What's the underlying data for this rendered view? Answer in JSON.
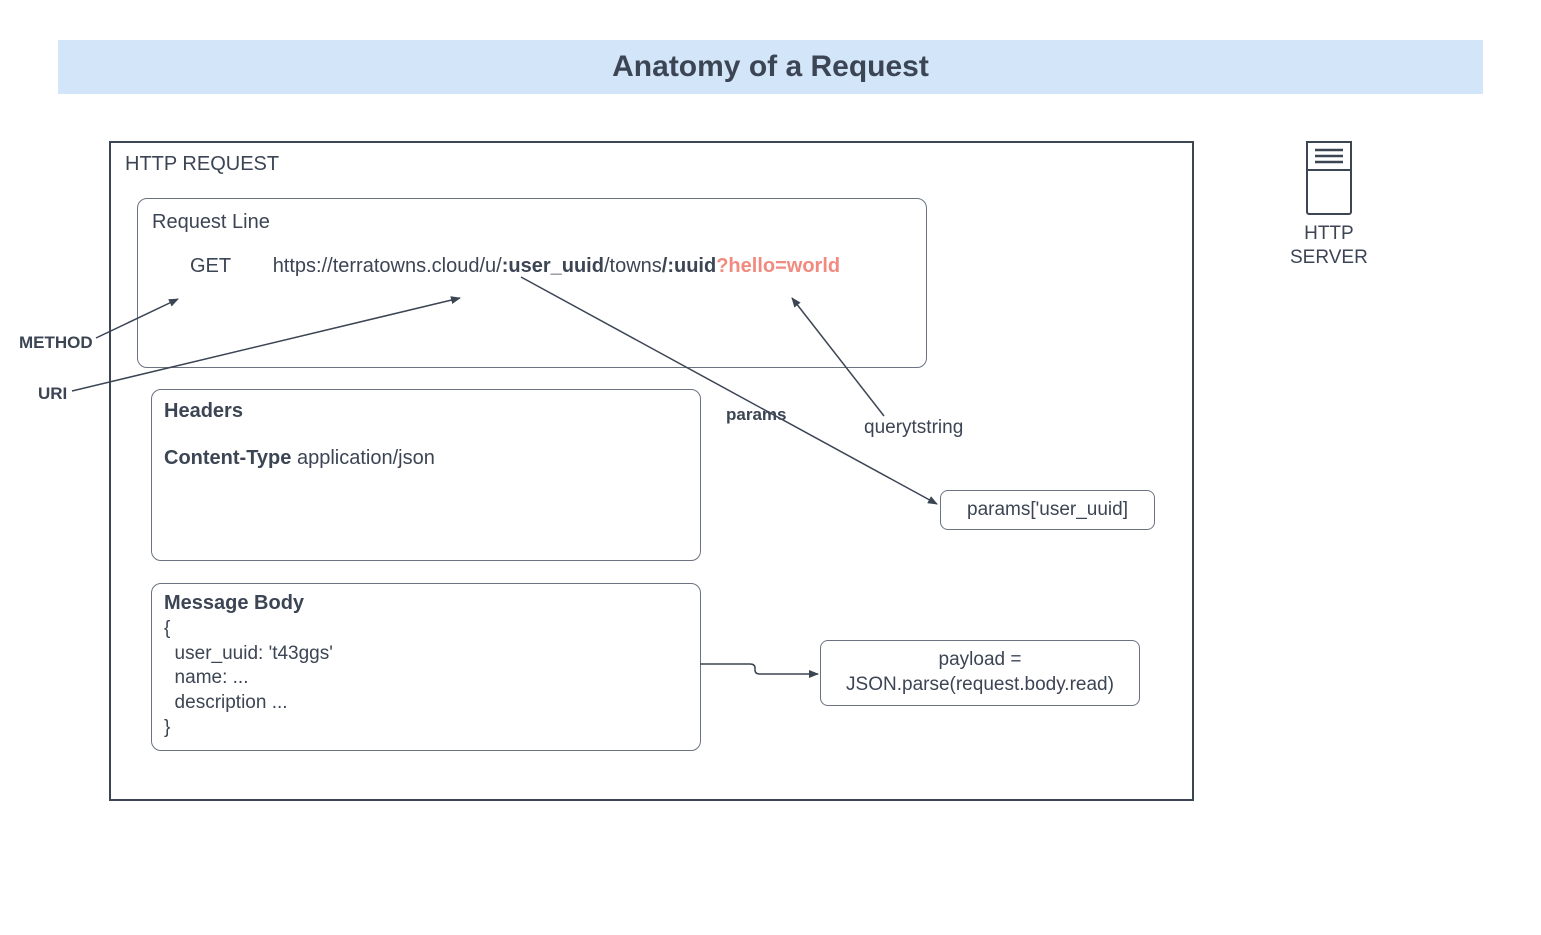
{
  "title": "Anatomy of a Request",
  "http_request_label": "HTTP REQUEST",
  "http_server_label": "HTTP\nSERVER",
  "request_line": {
    "label": "Request Line",
    "method": "GET",
    "url_base": "https://terratowns.cloud/u/",
    "url_user_param": ":user_uuid",
    "url_mid": "/towns",
    "url_uuid_param": "/:uuid",
    "url_query": "?hello=world"
  },
  "headers": {
    "label": "Headers",
    "content_type_key": "Content-Type",
    "content_type_value": "application/json"
  },
  "message_body": {
    "label": "Message Body",
    "content": "{\n  user_uuid: 't43ggs'\n  name: ...\n  description ...\n}"
  },
  "annotations": {
    "method_label": "METHOD",
    "uri_label": "URI",
    "params_label": "params",
    "querystring_label": "querytstring",
    "params_box": "params['user_uuid]",
    "payload_box": "payload =\nJSON.parse(request.body.read)"
  }
}
